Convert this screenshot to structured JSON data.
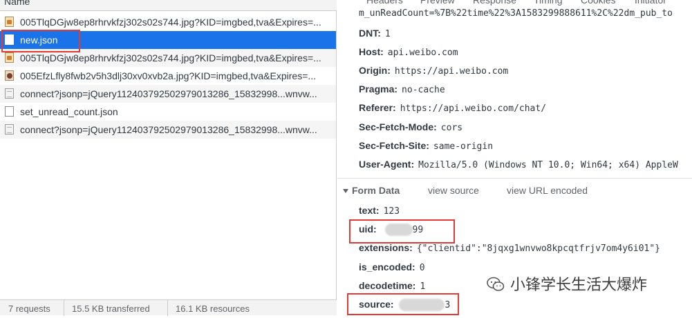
{
  "network": {
    "column_name": "Name",
    "requests": [
      {
        "name": "005TlqDGjw8ep8rhrvkfzj302s02s744.jpg?KID=imgbed,tva&Expires=...",
        "icon": "image-file-icon"
      },
      {
        "name": "new.json",
        "icon": "document-file-icon"
      },
      {
        "name": "005TlqDGjw8ep8rhrvkfzj302s02s744.jpg?KID=imgbed,tva&Expires=...",
        "icon": "image-file-icon"
      },
      {
        "name": "005EfzLfly8fwb2v5h3dlj30xv0xvb2a.jpg?KID=imgbed,tva&Expires=...",
        "icon": "image-file-icon"
      },
      {
        "name": "connect?jsonp=jQuery11240379250297901​3286_15832998...wnvw...",
        "icon": "script-file-icon"
      },
      {
        "name": "set_unread_count.json",
        "icon": "document-file-icon"
      },
      {
        "name": "connect?jsonp=jQuery11240379250297901​3286_15832998...wnvw...",
        "icon": "script-file-icon"
      }
    ],
    "status": {
      "requests": "7 requests",
      "transferred": "15.5 KB transferred",
      "resources": "16.1 KB resources"
    }
  },
  "details": {
    "tabs": [
      "Headers",
      "Preview",
      "Response",
      "Timing",
      "Cookies",
      "Initiator"
    ],
    "cut_line": "m_unReadCount=%7B%22time%22%3A1583299888611%2C%22dm_pub_to",
    "request_headers": [
      {
        "key": "DNT:",
        "value": "1"
      },
      {
        "key": "Host:",
        "value": "api.weibo.com"
      },
      {
        "key": "Origin:",
        "value": "https://api.weibo.com"
      },
      {
        "key": "Pragma:",
        "value": "no-cache"
      },
      {
        "key": "Referer:",
        "value": "https://api.weibo.com/chat/"
      },
      {
        "key": "Sec-Fetch-Mode:",
        "value": "cors"
      },
      {
        "key": "Sec-Fetch-Site:",
        "value": "same-origin"
      },
      {
        "key": "User-Agent:",
        "value": "Mozilla/5.0 (Windows NT 10.0; Win64; x64) AppleW"
      }
    ],
    "form_data": {
      "title": "Form Data",
      "view_source": "view source",
      "view_url_encoded": "view URL encoded",
      "fields": [
        {
          "key": "text:",
          "value": "123"
        },
        {
          "key": "uid:",
          "value": "99"
        },
        {
          "key": "extensions:",
          "value": "{\"clientid\":\"8jqxg1wnvwo8kpcqtfrjv7om4y6i01\"}"
        },
        {
          "key": "is_encoded:",
          "value": "0"
        },
        {
          "key": "decodetime:",
          "value": "1"
        },
        {
          "key": "source:",
          "value": "3"
        }
      ]
    }
  },
  "watermark": "小锋学长生活大爆炸",
  "colors": {
    "selected": "#1a73e8",
    "highlight_box": "#e53935"
  }
}
